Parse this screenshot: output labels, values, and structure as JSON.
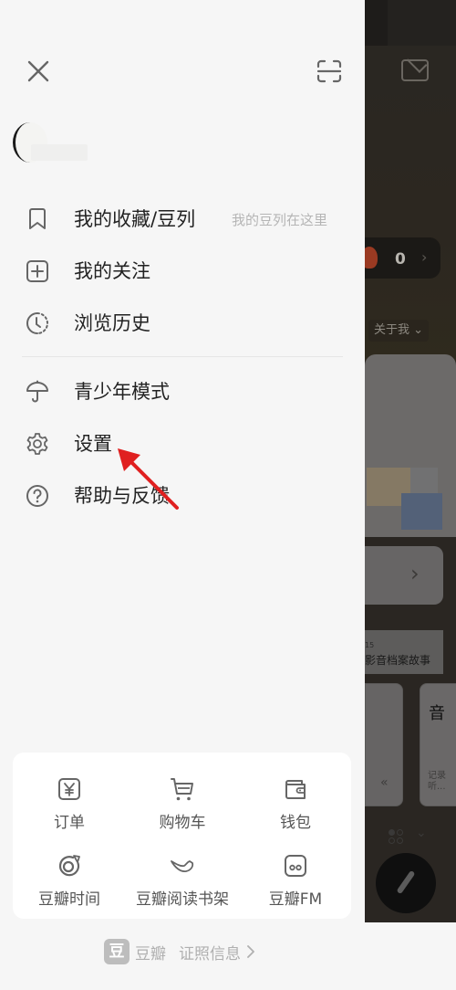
{
  "drawer": {
    "header": {
      "close_icon": "close-icon",
      "scan_icon": "scan-icon"
    },
    "profile": {
      "avatar": "avatar",
      "username": ""
    },
    "menu": [
      {
        "id": "favorites",
        "icon": "bookmark-icon",
        "label": "我的收藏/豆列",
        "hint": "我的豆列在这里"
      },
      {
        "id": "following",
        "icon": "plus-square-icon",
        "label": "我的关注"
      },
      {
        "id": "history",
        "icon": "history-clock-icon",
        "label": "浏览历史"
      },
      {
        "id": "teen-mode",
        "icon": "umbrella-icon",
        "label": "青少年模式"
      },
      {
        "id": "settings",
        "icon": "gear-icon",
        "label": "设置"
      },
      {
        "id": "help",
        "icon": "question-icon",
        "label": "帮助与反馈"
      }
    ],
    "shortcuts": [
      {
        "id": "orders",
        "icon": "yen-icon",
        "label": "订单"
      },
      {
        "id": "cart",
        "icon": "cart-icon",
        "label": "购物车"
      },
      {
        "id": "wallet",
        "icon": "wallet-icon",
        "label": "钱包"
      },
      {
        "id": "douban-time",
        "icon": "douban-time-icon",
        "label": "豆瓣时间"
      },
      {
        "id": "reading-shelf",
        "icon": "bird-icon",
        "label": "豆瓣阅读书架"
      },
      {
        "id": "douban-fm",
        "icon": "fm-icon",
        "label": "豆瓣FM"
      }
    ],
    "footer": {
      "logo_char": "豆",
      "brand": "豆瓣",
      "license_link": "证照信息"
    }
  },
  "annotation": {
    "arrow_color": "#e02020",
    "points_to": "设置"
  },
  "background_app": {
    "badge_count": "0",
    "about_me": "关于我",
    "story_small": "15",
    "story_text": "影音档案故事",
    "tab_char": "音",
    "record_text": "记录 听..."
  },
  "colors": {
    "drawer_bg": "#f6f6f6",
    "text_primary": "#222222",
    "text_hint": "#b5b5b5",
    "icon_gray": "#666666"
  }
}
